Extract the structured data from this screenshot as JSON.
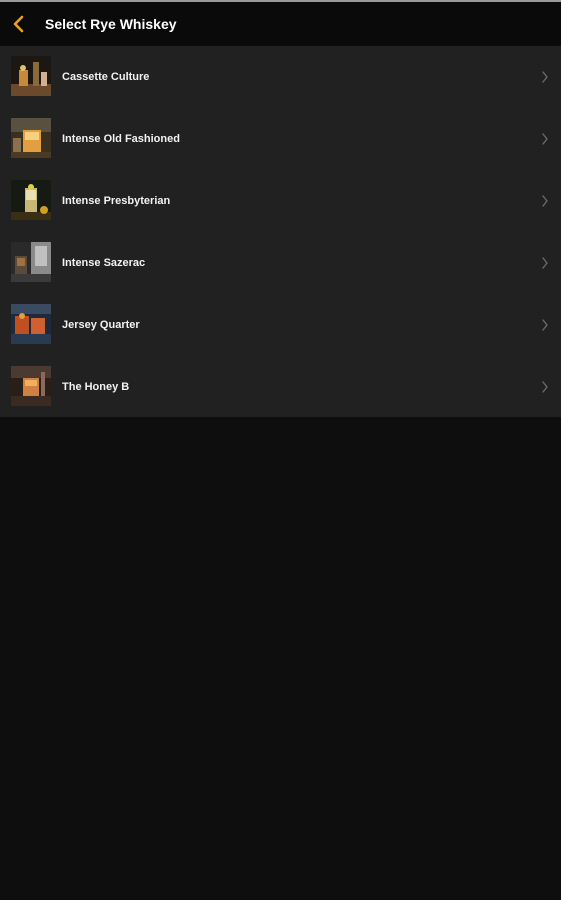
{
  "header": {
    "title": "Select Rye Whiskey",
    "back_icon": "chevron-left-icon",
    "accent_color": "#f0a020"
  },
  "list": {
    "items": [
      {
        "label": "Cassette Culture",
        "thumb_icon": "cocktail-photo"
      },
      {
        "label": "Intense Old Fashioned",
        "thumb_icon": "cocktail-photo"
      },
      {
        "label": "Intense Presbyterian",
        "thumb_icon": "cocktail-photo"
      },
      {
        "label": "Intense Sazerac",
        "thumb_icon": "cocktail-photo"
      },
      {
        "label": "Jersey Quarter",
        "thumb_icon": "cocktail-photo"
      },
      {
        "label": "The Honey B",
        "thumb_icon": "cocktail-photo"
      }
    ],
    "chevron_icon": "chevron-right-icon"
  }
}
